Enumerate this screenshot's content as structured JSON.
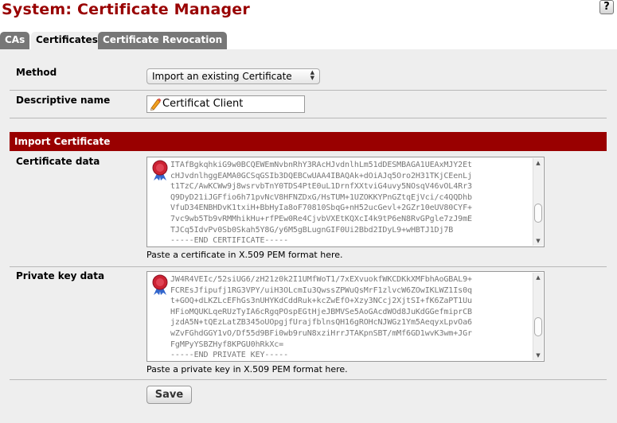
{
  "page": {
    "title": "System: Certificate Manager",
    "help_icon_text": "?"
  },
  "tabs": [
    {
      "label": "CAs",
      "active": false
    },
    {
      "label": "Certificates",
      "active": true
    },
    {
      "label": "Certificate Revocation",
      "active": false
    }
  ],
  "form": {
    "method": {
      "label": "Method",
      "selected": "Import an existing Certificate"
    },
    "descriptive_name": {
      "label": "Descriptive name",
      "value": "Certificat Client"
    },
    "import_section": {
      "header": "Import Certificate"
    },
    "certificate_data": {
      "label": "Certificate data",
      "text": "ITAfBgkqhkiG9w0BCQEWEmNvbnRhY3RAcHJvdnlhLm51dDESMBAGA1UEAxMJY2Et\ncHJvdnlhggEAMA0GCSqGSIb3DQEBCwUAA4IBAQAk+dOiAJq5Oro2H31TKjCEenLj\nt1TzC/AwKCWw9j8wsrvbTnY0TDS4PtE0uL1DrnfXXtviG4uvy5NOsqV46vOL4Rr3\nQ9DyD21iJGFfio6h71pvNcV8HFNZDxG/HsTUM+1UZOKKYPnGZtqEjVci/c4QQDhb\nVfuD34ENBHDvK1txiH+BbHyIa8oF70810SbqG+nH52ucGevl+2GZr10eUV80CYF+\n7vc9wb5Tb9vRMMhikHu+rfPEw0Re4CjvbVXEtKQXcI4k9tP6eN8RvGPgle7zJ9mE\nTJCq5IdvPv0Sb0Skah5Y8G/y6M5gBLugnGIF0Ui2Bbd2IDyL9+wHBTJ1Dj7B\n-----END CERTIFICATE-----",
      "hint": "Paste a certificate in X.509 PEM format here."
    },
    "private_key_data": {
      "label": "Private key data",
      "text": "JW4R4VEIc/52siUG6/zH21z0k2I1UMfWoT1/7xEXvuokfWKCDKkXMFbhAoGBAL9+\nFCREsJfipufj1RG3VPY/uiH3OLcmIu3QwssZPWuQsMrF1zlvcW6ZOwIKLWZ1Is0q\nt+GOQ+dLKZLcEFhGs3nUHYKdCddRuk+kcZwEfO+Xzy3NCcj2XjtSI+fK6ZaPT1Uu\nHFioMQUKLqeRUzTyIA6cRgqPOspEGtHjeJBMVSe5AoGAcdWOd8JuKdGGefmiprCB\njzdA5N+tQEzLatZB345oUOpgjfUrajfblnsQH16gROHcNJWGz1Ym5AeqyxLpvOa6\nwZvFGhdGGY1vO/Df55d9BFi0wb9ruN8xziHrrJTAKpnSBT/mMf6GD1wvK3wm+JGr\nFgMPyYSBZHyf8KPGU0hRkXc=\n-----END PRIVATE KEY-----",
      "hint": "Paste a private key in X.509 PEM format here."
    },
    "save_label": "Save"
  },
  "colors": {
    "title_red": "#990000",
    "section_header_bg": "#990000",
    "tab_inactive_bg": "#777777",
    "panel_bg": "#eeeeee"
  },
  "icons": {
    "help": "help-icon",
    "pencil": "pencil-icon",
    "certificate": "certificate-seal-icon"
  }
}
